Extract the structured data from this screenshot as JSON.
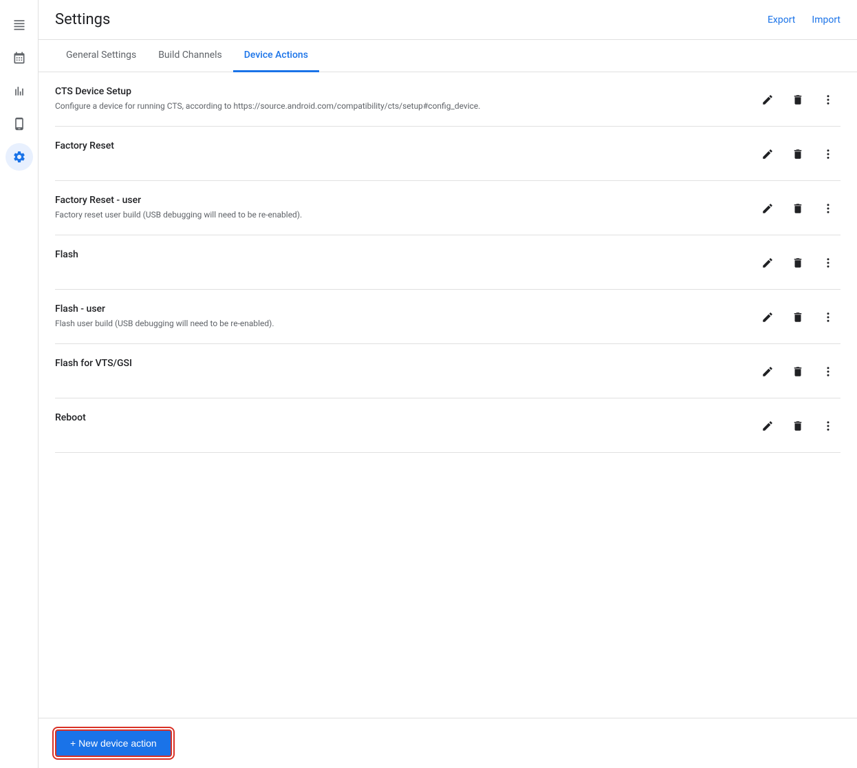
{
  "header": {
    "title": "Settings",
    "export_label": "Export",
    "import_label": "Import"
  },
  "tabs": [
    {
      "id": "general",
      "label": "General Settings",
      "active": false
    },
    {
      "id": "build-channels",
      "label": "Build Channels",
      "active": false
    },
    {
      "id": "device-actions",
      "label": "Device Actions",
      "active": true
    }
  ],
  "sidebar": {
    "items": [
      {
        "id": "list",
        "icon": "☰",
        "label": "List"
      },
      {
        "id": "calendar",
        "icon": "📅",
        "label": "Calendar"
      },
      {
        "id": "chart",
        "icon": "📊",
        "label": "Chart"
      },
      {
        "id": "device",
        "icon": "📱",
        "label": "Device"
      },
      {
        "id": "settings",
        "icon": "⚙",
        "label": "Settings",
        "active": true
      }
    ]
  },
  "actions": [
    {
      "id": "cts-device-setup",
      "name": "CTS Device Setup",
      "description": "Configure a device for running CTS, according to https://source.android.com/compatibility/cts/setup#config_device."
    },
    {
      "id": "factory-reset",
      "name": "Factory Reset",
      "description": null
    },
    {
      "id": "factory-reset-user",
      "name": "Factory Reset - user",
      "description": "Factory reset user build (USB debugging will need to be re-enabled)."
    },
    {
      "id": "flash",
      "name": "Flash",
      "description": null
    },
    {
      "id": "flash-user",
      "name": "Flash - user",
      "description": "Flash user build (USB debugging will need to be re-enabled)."
    },
    {
      "id": "flash-vts-gsi",
      "name": "Flash for VTS/GSI",
      "description": null
    },
    {
      "id": "reboot",
      "name": "Reboot",
      "description": null
    }
  ],
  "footer": {
    "new_action_label": "+ New device action"
  }
}
